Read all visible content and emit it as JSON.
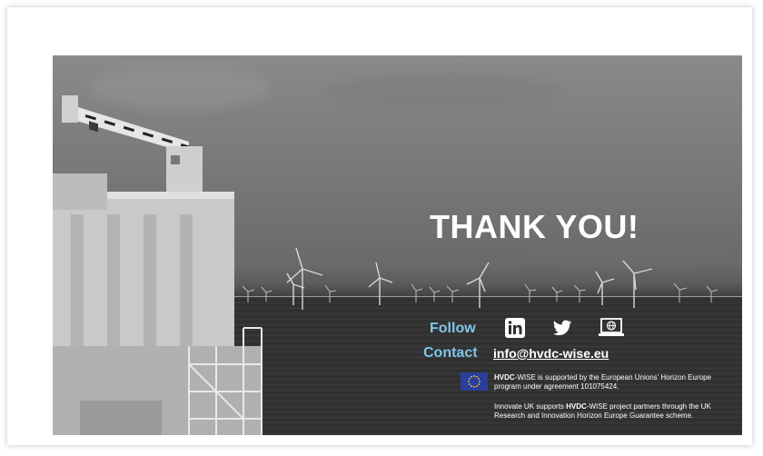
{
  "slide": {
    "title": "THANK YOU!",
    "follow_label": "Follow",
    "contact_label": "Contact",
    "email": "info@hvdc-wise.eu",
    "social_icons": [
      "linkedin-icon",
      "twitter-icon",
      "website-icon"
    ],
    "eu_notice_bold": "HVDC",
    "eu_notice_rest": "-WISE is supported by the European Unions' Horizon Europe program under agreement 101075424.",
    "uk_notice_pre": "Innovate UK supports ",
    "uk_notice_bold": "HVDC",
    "uk_notice_rest": "-WISE project partners through the UK Research and Innovation Horizon Europe Guarantee scheme."
  },
  "colors": {
    "accent": "#7fc6ea",
    "eu_blue": "#2a3e9e",
    "eu_star": "#ffd617"
  }
}
